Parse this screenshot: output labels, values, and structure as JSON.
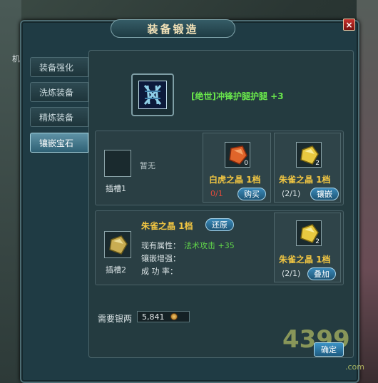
{
  "background": {
    "side_char": "机"
  },
  "window": {
    "title": "装备锻造",
    "close_label": "×"
  },
  "tabs": [
    {
      "label": "装备强化",
      "active": false
    },
    {
      "label": "洗炼装备",
      "active": false
    },
    {
      "label": "精炼装备",
      "active": false
    },
    {
      "label": "镶嵌宝石",
      "active": true
    }
  ],
  "item": {
    "name": "[绝世]冲锋护腿护腿 +3",
    "name_color": "#68e34b"
  },
  "slot1": {
    "label": "插槽1",
    "empty_text": "暂无",
    "gem_a": {
      "name": "白虎之晶 1档",
      "count": "0",
      "owned": "0/1",
      "button": "购买",
      "color": "orange"
    },
    "gem_b": {
      "name": "朱雀之晶 1档",
      "count": "2",
      "owned": "(2/1)",
      "button": "镶嵌",
      "color": "yellow"
    }
  },
  "slot2": {
    "label": "插槽2",
    "gem_name": "朱雀之晶 1档",
    "restore_button": "还原",
    "attr_label": "现有属性：",
    "attr_value": "法术攻击 +35",
    "enhance_label": "镶嵌增强：",
    "success_label": "成 功 率：",
    "gem_b": {
      "name": "朱雀之晶 1档",
      "count": "2",
      "owned": "(2/1)",
      "button": "叠加",
      "color": "yellow"
    }
  },
  "cost": {
    "label": "需要银两",
    "value": "5,841"
  },
  "confirm_button": "确定",
  "watermark": {
    "main": "4399",
    "suffix": ".com"
  }
}
